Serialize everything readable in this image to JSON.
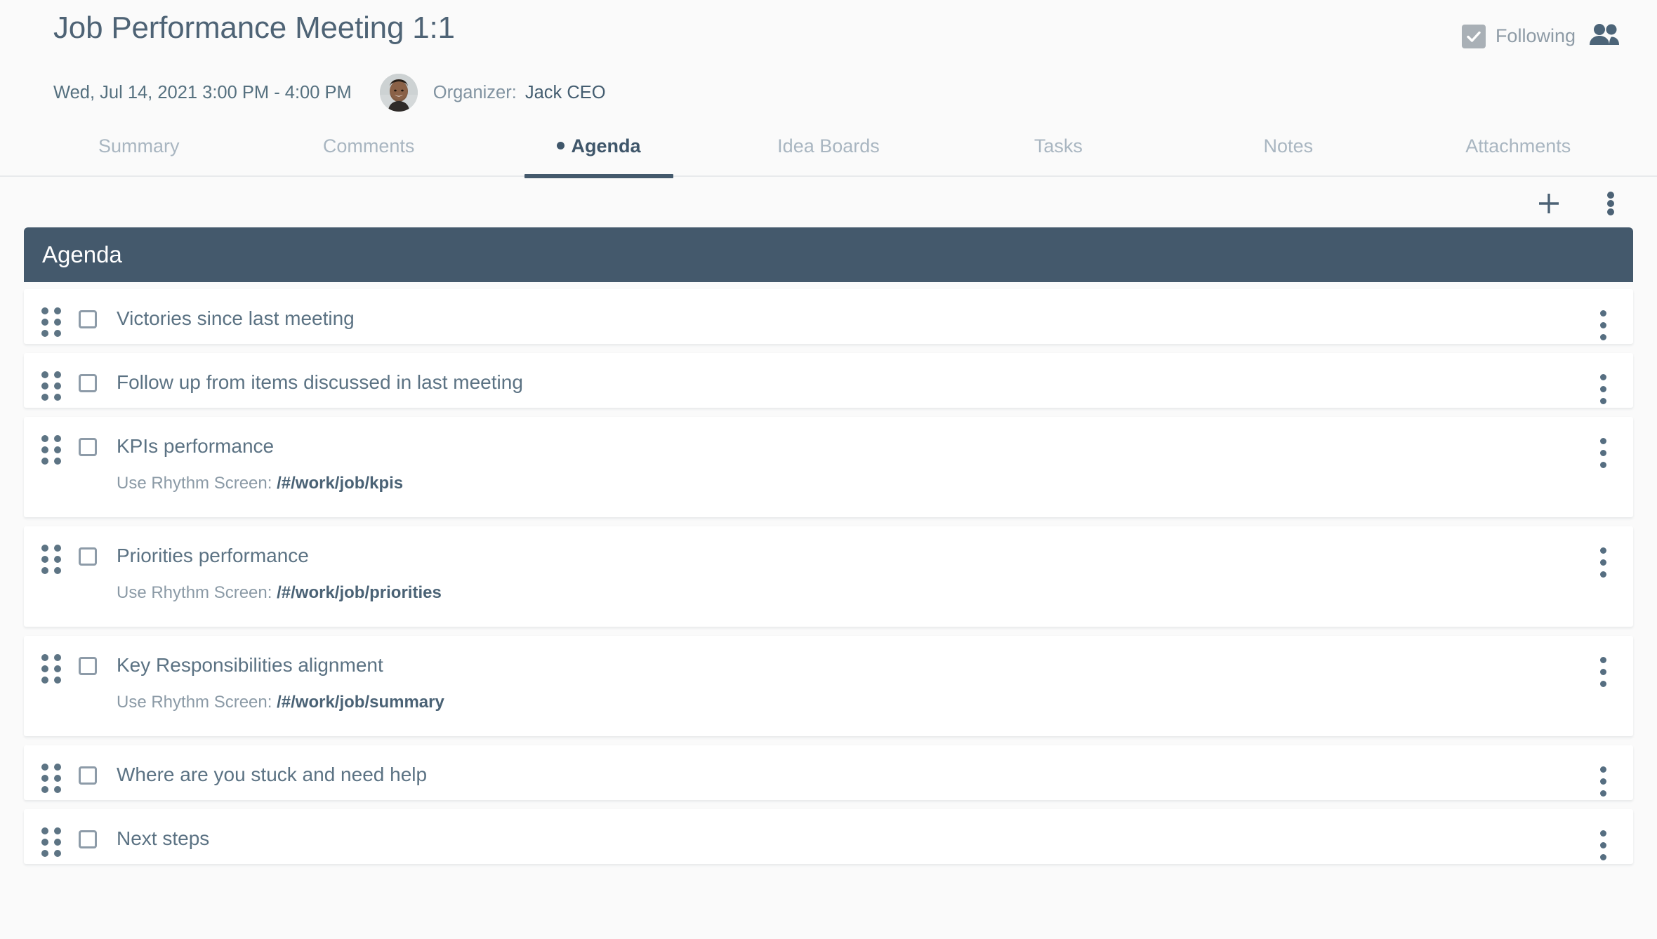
{
  "header": {
    "title": "Job Performance Meeting 1:1",
    "date_range": "Wed, Jul 14, 2021 3:00 PM - 4:00 PM",
    "organizer_label": "Organizer:",
    "organizer_name": "Jack CEO",
    "following_label": "Following",
    "following_checked": true,
    "people_icon": "people-icon",
    "check_icon": "checkmark-icon",
    "avatar_icon": "organizer-avatar"
  },
  "tabs": [
    {
      "label": "Summary",
      "active": false
    },
    {
      "label": "Comments",
      "active": false
    },
    {
      "label": "Agenda",
      "active": true
    },
    {
      "label": "Idea Boards",
      "active": false
    },
    {
      "label": "Tasks",
      "active": false
    },
    {
      "label": "Notes",
      "active": false
    },
    {
      "label": "Attachments",
      "active": false
    }
  ],
  "toolbar": {
    "add_icon": "plus-icon",
    "more_icon": "more-vertical-icon"
  },
  "agenda": {
    "card_title": "Agenda",
    "header_color": "#44596c",
    "items": [
      {
        "title": "Victories since last meeting",
        "checked": false,
        "sub_label": "",
        "sub_path": ""
      },
      {
        "title": "Follow up from items discussed in last meeting",
        "checked": false,
        "sub_label": "",
        "sub_path": ""
      },
      {
        "title": "KPIs performance",
        "checked": false,
        "sub_label": "Use Rhythm Screen:",
        "sub_path": "/#/work/job/kpis"
      },
      {
        "title": "Priorities performance",
        "checked": false,
        "sub_label": "Use Rhythm Screen:",
        "sub_path": "/#/work/job/priorities"
      },
      {
        "title": "Key Responsibilities alignment",
        "checked": false,
        "sub_label": "Use Rhythm Screen:",
        "sub_path": "/#/work/job/summary"
      },
      {
        "title": "Where are you stuck and need help",
        "checked": false,
        "sub_label": "",
        "sub_path": ""
      },
      {
        "title": "Next steps",
        "checked": false,
        "sub_label": "",
        "sub_path": ""
      }
    ]
  },
  "colors": {
    "accent": "#44596c",
    "page_bg": "#fafafa",
    "row_bg": "#ffffff",
    "muted_text": "#a9b6c1",
    "body_text": "#5b7283"
  }
}
